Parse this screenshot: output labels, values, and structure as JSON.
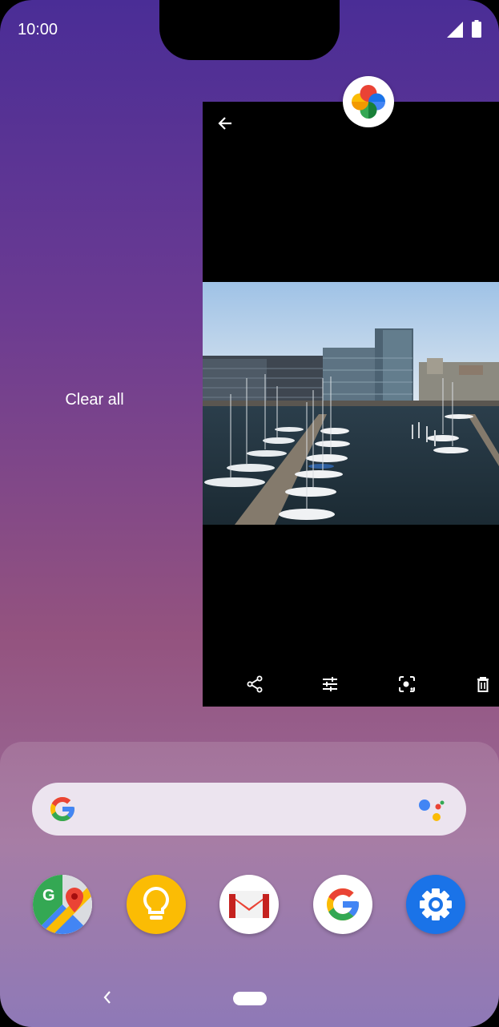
{
  "status_bar": {
    "time": "10:00"
  },
  "recents": {
    "clear_all_label": "Clear all",
    "card_app_icon": "google-photos-icon",
    "card_toolbar_icons": [
      "share-icon",
      "edit-sliders-icon",
      "lens-icon",
      "delete-icon"
    ]
  },
  "dock": {
    "search_logo": "google-g-icon",
    "assistant_icon": "assistant-dots-icon",
    "apps": [
      "maps-icon",
      "keep-icon",
      "gmail-icon",
      "google-icon",
      "settings-icon"
    ]
  },
  "nav": {
    "back_icon": "back-chevron-icon",
    "home_icon": "home-pill-icon"
  },
  "colors": {
    "google_blue": "#4285F4",
    "google_red": "#EA4335",
    "google_yellow": "#FBBC05",
    "google_green": "#34A853",
    "settings_blue": "#1a73e8",
    "keep_yellow": "#FBBC04"
  }
}
